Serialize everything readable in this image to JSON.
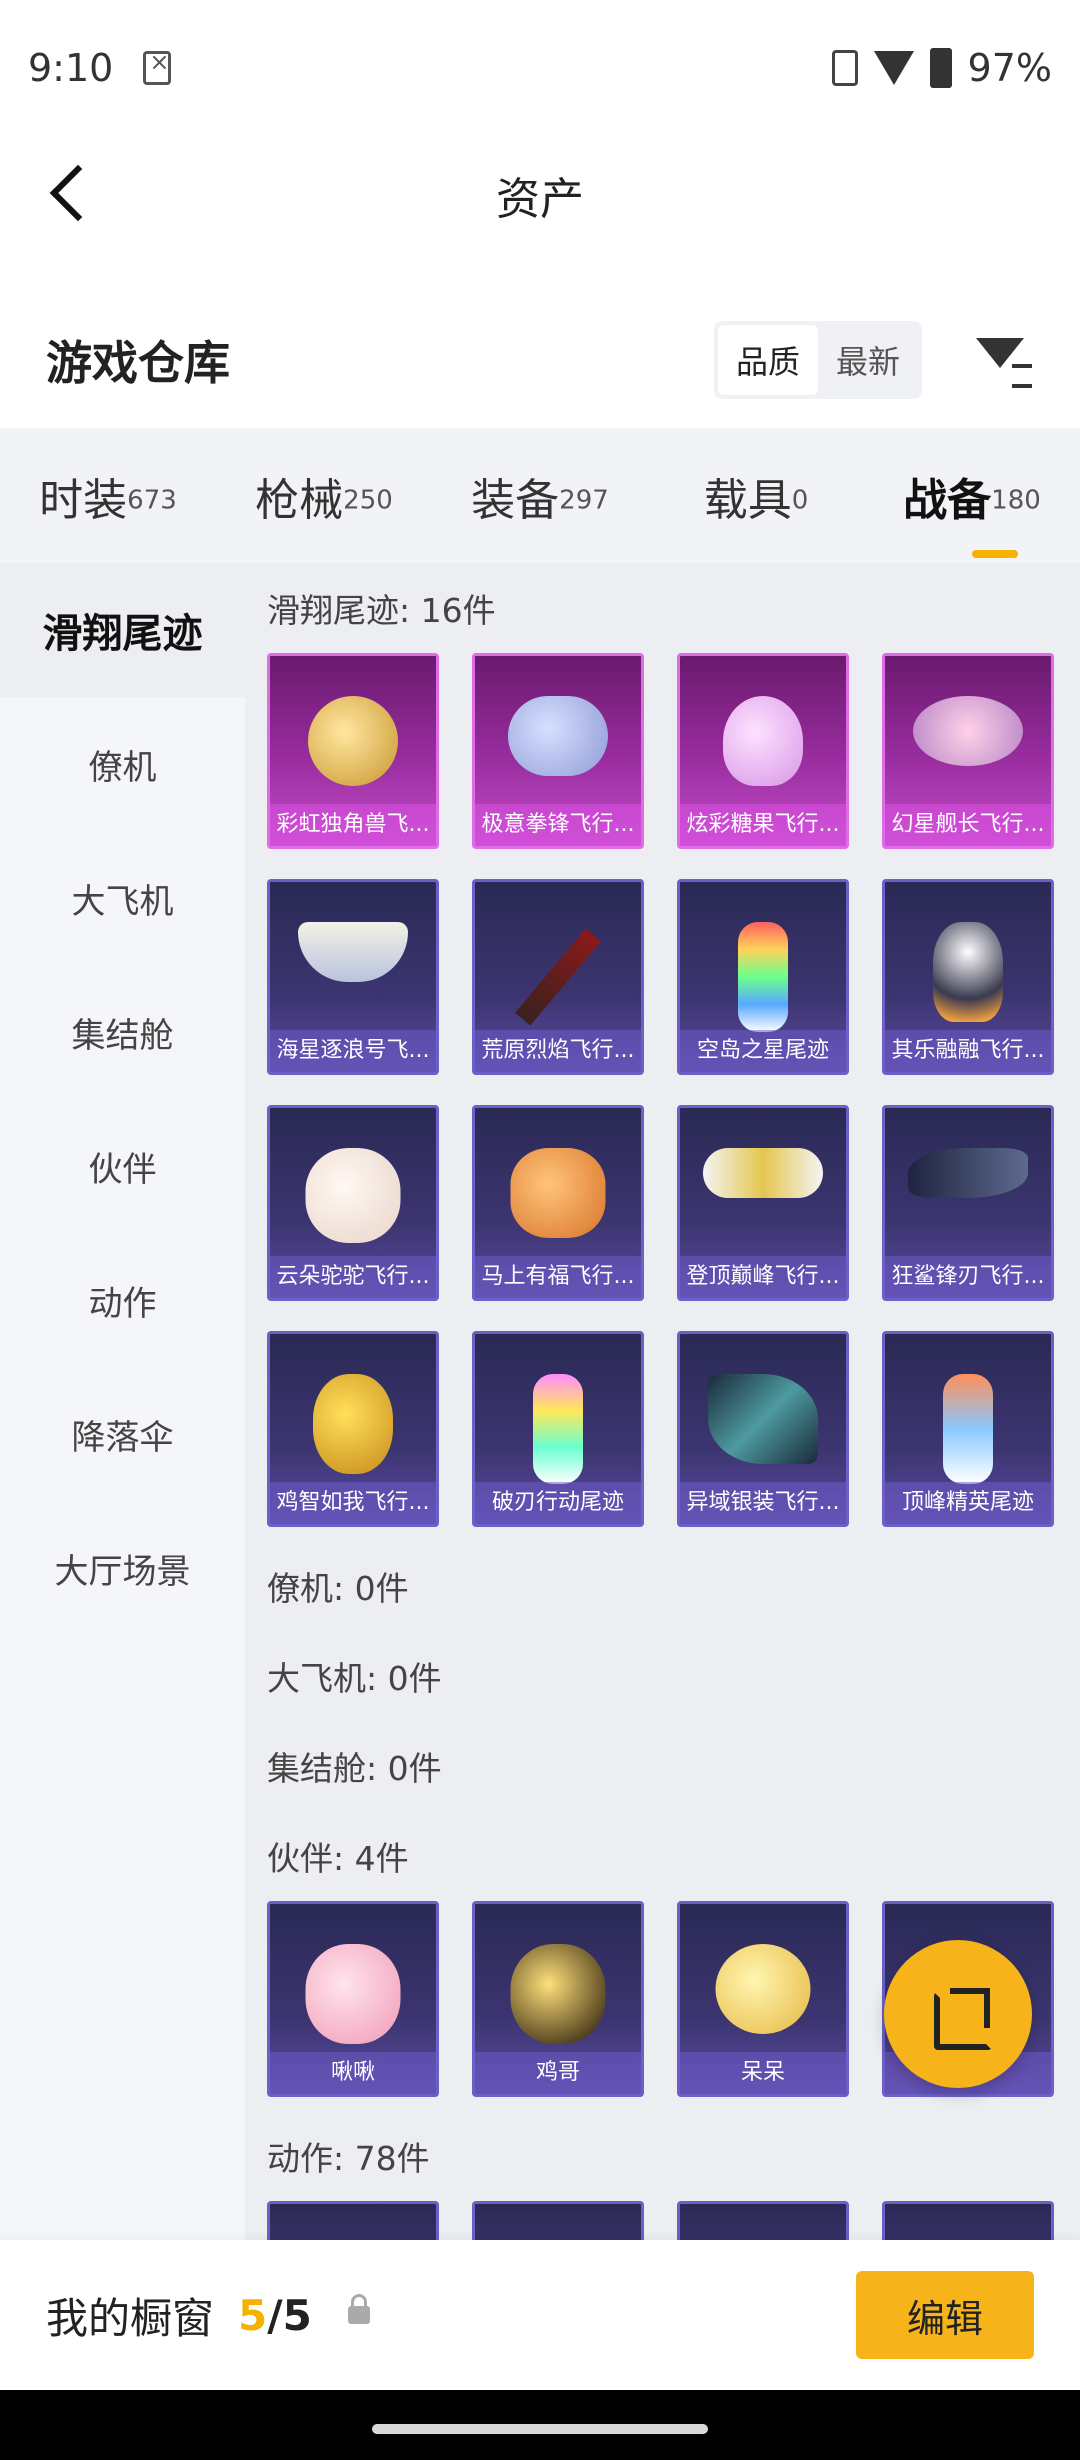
{
  "status_bar": {
    "time": "9:10",
    "battery": "97%"
  },
  "header": {
    "title": "资产"
  },
  "warehouse": {
    "title": "游戏仓库",
    "sort_quality": "品质",
    "sort_newest": "最新"
  },
  "categories": [
    {
      "label": "时装",
      "count": "673"
    },
    {
      "label": "枪械",
      "count": "250"
    },
    {
      "label": "装备",
      "count": "297"
    },
    {
      "label": "载具",
      "count": "0"
    },
    {
      "label": "战备",
      "count": "180"
    }
  ],
  "sidebar": [
    "滑翔尾迹",
    "僚机",
    "大飞机",
    "集结舱",
    "伙伴",
    "动作",
    "降落伞",
    "大厅场景"
  ],
  "sections": {
    "glide": {
      "title": "滑翔尾迹: 16件",
      "items": [
        "彩虹独角兽飞...",
        "极意拳锋飞行...",
        "炫彩糖果飞行...",
        "幻星舰长飞行...",
        "海星逐浪号飞...",
        "荒原烈焰飞行...",
        "空岛之星尾迹",
        "其乐融融飞行...",
        "云朵驼驼飞行...",
        "马上有福飞行...",
        "登顶巅峰飞行...",
        "狂鲨锋刃飞行...",
        "鸡智如我飞行...",
        "破刃行动尾迹",
        "异域银装飞行...",
        "顶峰精英尾迹"
      ]
    },
    "wingman": {
      "title": "僚机: 0件"
    },
    "plane": {
      "title": "大飞机: 0件"
    },
    "capsule": {
      "title": "集结舱: 0件"
    },
    "partner": {
      "title": "伙伴: 4件",
      "items": [
        "啾啾",
        "鸡哥",
        "呆呆",
        ""
      ]
    },
    "action": {
      "title": "动作: 78件"
    }
  },
  "bottom": {
    "label": "我的橱窗",
    "current": "5",
    "total": "/5",
    "edit": "编辑"
  },
  "icons": [
    "back-icon",
    "filter-icon",
    "share-icon",
    "lock-icon"
  ],
  "colors": {
    "accent": "#f6b31a",
    "rare_purple": "#c44fc8",
    "epic_blue": "#5a4ca0"
  }
}
